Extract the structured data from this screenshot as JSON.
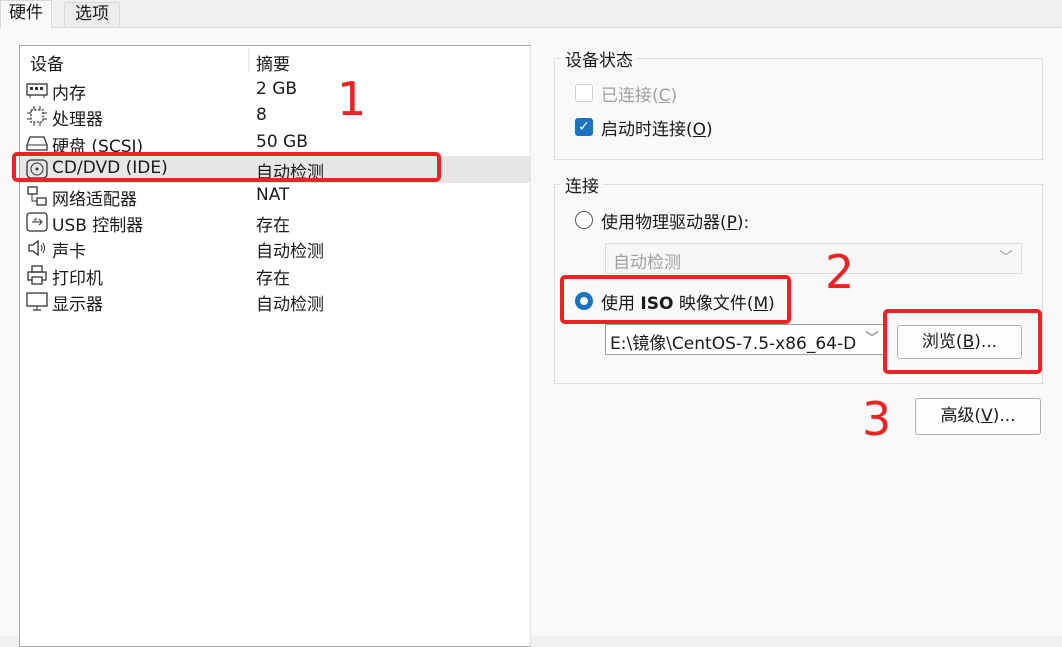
{
  "tabs": [
    {
      "label": "硬件"
    },
    {
      "label": "选项"
    }
  ],
  "device_list": {
    "col_device": "设备",
    "col_summary": "摘要",
    "rows": [
      {
        "icon": "memory-icon",
        "device": "内存",
        "summary": "2 GB"
      },
      {
        "icon": "cpu-icon",
        "device": "处理器",
        "summary": "8"
      },
      {
        "icon": "harddisk-icon",
        "device": "硬盘 (SCSI)",
        "summary": "50 GB"
      },
      {
        "icon": "cd-dvd-icon",
        "device": "CD/DVD (IDE)",
        "summary": "自动检测"
      },
      {
        "icon": "network-adapter-icon",
        "device": "网络适配器",
        "summary": "NAT"
      },
      {
        "icon": "usb-icon",
        "device": "USB 控制器",
        "summary": "存在"
      },
      {
        "icon": "sound-icon",
        "device": "声卡",
        "summary": "自动检测"
      },
      {
        "icon": "printer-icon",
        "device": "打印机",
        "summary": "存在"
      },
      {
        "icon": "display-icon",
        "device": "显示器",
        "summary": "自动检测"
      }
    ]
  },
  "device_status": {
    "title": "设备状态",
    "connected_label": "已连接(",
    "connected_key": "C",
    "connected_checked": false,
    "connect_on_start_label": "启动时连接(",
    "connect_on_start_key": "O",
    "connect_on_start_checked": true
  },
  "connection": {
    "title": "连接",
    "physical_label": "使用物理驱动器(",
    "physical_key": "P",
    "physical_select_value": "自动检测",
    "iso_label_pre": "使用 ",
    "iso_label_bold": "ISO",
    "iso_label_post": " 映像文件(",
    "iso_key": "M",
    "iso_path": "E:\\镜像\\CentOS-7.5-x86_64-D",
    "browse_label": "浏览(",
    "browse_key": "B",
    "browse_suffix": ")..."
  },
  "advanced": {
    "label": "高级(",
    "key": "V",
    "suffix": ")..."
  },
  "annotations": {
    "one": "1",
    "two": "2",
    "three": "3"
  }
}
